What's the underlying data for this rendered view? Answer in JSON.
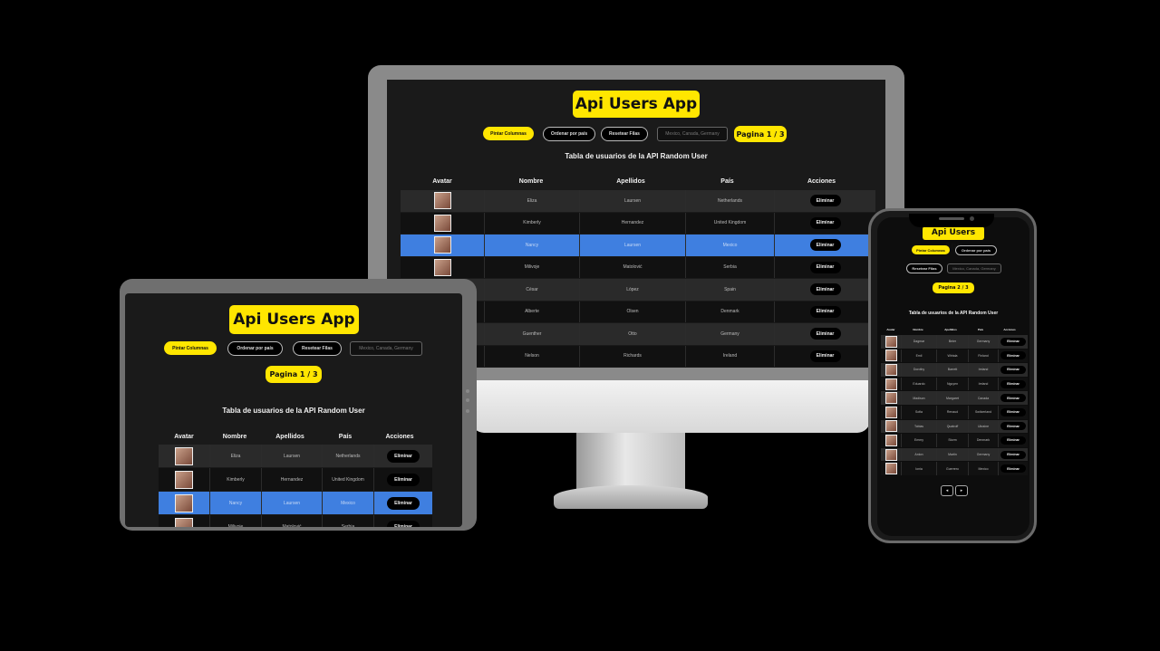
{
  "app": {
    "title": "Api Users App",
    "buttons": {
      "paint_columns": "Pintar Columnas",
      "sort_by_country": "Ordenar por país",
      "reset_rows": "Resetear Filas"
    },
    "filter_placeholder": "Mexico, Canada, Germany",
    "table_title": "Tabla de usuarios de la API Random User",
    "columns": [
      "Avatar",
      "Nombre",
      "Apellidos",
      "País",
      "Acciones"
    ],
    "delete_label": "Eliminar",
    "accent_color": "#ffe600",
    "selected_row_color": "#3f7fe0"
  },
  "desktop": {
    "page_label": "Pagina 1 / 3",
    "rows": [
      {
        "nombre": "Eliza",
        "apellidos": "Laursen",
        "pais": "Netherlands",
        "style": "g"
      },
      {
        "nombre": "Kimberly",
        "apellidos": "Hernandez",
        "pais": "United Kingdom",
        "style": "b"
      },
      {
        "nombre": "Nancy",
        "apellidos": "Laursen",
        "pais": "Mexico",
        "style": "sel"
      },
      {
        "nombre": "Milivoje",
        "apellidos": "Matolović",
        "pais": "Serbia",
        "style": "b"
      },
      {
        "nombre": "César",
        "apellidos": "López",
        "pais": "Spain",
        "style": "g"
      },
      {
        "nombre": "Alberte",
        "apellidos": "Olsen",
        "pais": "Denmark",
        "style": "b"
      },
      {
        "nombre": "Guenther",
        "apellidos": "Otto",
        "pais": "Germany",
        "style": "g"
      },
      {
        "nombre": "Nelson",
        "apellidos": "Richards",
        "pais": "Ireland",
        "style": "b"
      }
    ]
  },
  "tablet": {
    "page_label": "Pagina 1 / 3",
    "rows": [
      {
        "nombre": "Eliza",
        "apellidos": "Laursen",
        "pais": "Netherlands",
        "style": "g"
      },
      {
        "nombre": "Kimberly",
        "apellidos": "Hernandez",
        "pais": "United Kingdom",
        "style": "b"
      },
      {
        "nombre": "Nancy",
        "apellidos": "Laursen",
        "pais": "Mexico",
        "style": "sel"
      },
      {
        "nombre": "Milivoje",
        "apellidos": "Matolović",
        "pais": "Serbia",
        "style": "b"
      }
    ]
  },
  "phone": {
    "page_label": "Pagina 2 / 3",
    "rows": [
      {
        "nombre": "Dagmar",
        "apellidos": "Beier",
        "pais": "Germany",
        "style": "g"
      },
      {
        "nombre": "Emil",
        "apellidos": "Wirtala",
        "pais": "Finland",
        "style": "b"
      },
      {
        "nombre": "Dorothy",
        "apellidos": "Barrett",
        "pais": "Ireland",
        "style": "g"
      },
      {
        "nombre": "Eduardo",
        "apellidos": "Nguyen",
        "pais": "Ireland",
        "style": "b"
      },
      {
        "nombre": "Madison",
        "apellidos": "Margaret",
        "pais": "Canada",
        "style": "g"
      },
      {
        "nombre": "Sofia",
        "apellidos": "Renaud",
        "pais": "Switzerland",
        "style": "b"
      },
      {
        "nombre": "Tobias",
        "apellidos": "Quatroff",
        "pais": "Ukraine",
        "style": "g"
      },
      {
        "nombre": "Emmy",
        "apellidos": "Storm",
        "pais": "Denmark",
        "style": "b"
      },
      {
        "nombre": "Anton",
        "apellidos": "Martin",
        "pais": "Germany",
        "style": "g"
      },
      {
        "nombre": "Ionia",
        "apellidos": "Guerrero",
        "pais": "Mexico",
        "style": "b"
      }
    ],
    "prev_label": "◂",
    "next_label": "▸"
  }
}
